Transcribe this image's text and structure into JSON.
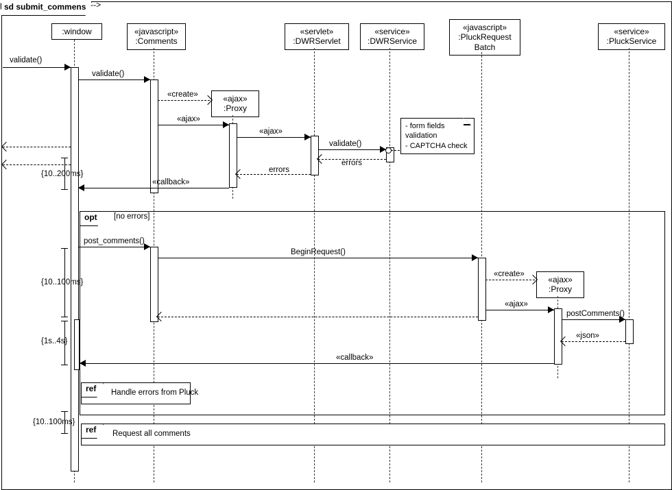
{
  "frame": {
    "title": "sd submit_commens"
  },
  "lifelines": {
    "window": {
      "stereotype": "",
      "name": ":window"
    },
    "comments": {
      "stereotype": "«javascript»",
      "name": ":Comments"
    },
    "proxy1": {
      "stereotype": "«ajax»",
      "name": ":Proxy"
    },
    "dwrservlet": {
      "stereotype": "«servlet»",
      "name": ":DWRServlet"
    },
    "dwrservice": {
      "stereotype": "«service»",
      "name": ":DWRService"
    },
    "pluckreq": {
      "stereotype": "«javascript»",
      "name": ":PluckRequest",
      "name2": "Batch"
    },
    "proxy2": {
      "stereotype": "«ajax»",
      "name": ":Proxy"
    },
    "pluckservice": {
      "stereotype": "«service»",
      "name": ":PluckService"
    }
  },
  "messages": {
    "m_validate_in": "validate()",
    "m_validate_to_c": "validate()",
    "m_create1": "«create»",
    "m_ajax1": "«ajax»",
    "m_ajax2": "«ajax»",
    "m_validate_srv": "validate()",
    "m_errors1": "errors",
    "m_errors2": "errors",
    "m_callback1": "«callback»",
    "m_postcomments": "post_comments()",
    "m_beginreq": "BeginRequest()",
    "m_create2": "«create»",
    "m_ajax3": "«ajax»",
    "m_postc": "postComments()",
    "m_json": "«json»",
    "m_callback2": "«callback»"
  },
  "note": {
    "l1": "- form fields",
    "l2": "validation",
    "l3": "- CAPTCHA check"
  },
  "durations": {
    "d1": "{10..200ms}",
    "d2": "{10..100ms}",
    "d3": "{1s..4s}",
    "d4": "{10..100ms}"
  },
  "fragments": {
    "opt": {
      "op": "opt",
      "guard": "[no errors]"
    },
    "ref1": {
      "op": "ref",
      "text": "Handle errors from Pluck"
    },
    "ref2": {
      "op": "ref",
      "text": "Request all comments"
    }
  },
  "chart_data": {
    "type": "sequence-diagram",
    "frame": "sd submit_commens",
    "lifelines": [
      {
        "id": "window",
        "name": ":window"
      },
      {
        "id": "comments",
        "stereotype": "javascript",
        "name": ":Comments"
      },
      {
        "id": "proxy1",
        "stereotype": "ajax",
        "name": ":Proxy",
        "created_by": "comments"
      },
      {
        "id": "dwrservlet",
        "stereotype": "servlet",
        "name": ":DWRServlet"
      },
      {
        "id": "dwrservice",
        "stereotype": "service",
        "name": ":DWRService"
      },
      {
        "id": "pluckreq",
        "stereotype": "javascript",
        "name": ":PluckRequestBatch"
      },
      {
        "id": "proxy2",
        "stereotype": "ajax",
        "name": ":Proxy",
        "created_by": "pluckreq"
      },
      {
        "id": "pluckservice",
        "stereotype": "service",
        "name": ":PluckService"
      }
    ],
    "messages": [
      {
        "from": "(external)",
        "to": "window",
        "label": "validate()",
        "dashed": false
      },
      {
        "from": "window",
        "to": "comments",
        "label": "validate()",
        "dashed": false
      },
      {
        "from": "comments",
        "to": "proxy1",
        "label": "«create»",
        "dashed": true
      },
      {
        "from": "comments",
        "to": "proxy1",
        "label": "«ajax»",
        "dashed": false
      },
      {
        "from": "proxy1",
        "to": "dwrservlet",
        "label": "«ajax»",
        "dashed": false
      },
      {
        "from": "dwrservlet",
        "to": "dwrservice",
        "label": "validate()",
        "dashed": false,
        "note": "- form fields validation - CAPTCHA check"
      },
      {
        "from": "dwrservice",
        "to": "dwrservlet",
        "label": "errors",
        "dashed": true
      },
      {
        "from": "dwrservlet",
        "to": "proxy1",
        "label": "errors",
        "dashed": true
      },
      {
        "from": "proxy1",
        "to": "window",
        "label": "",
        "dashed": true
      },
      {
        "from": "proxy1",
        "to": "window",
        "label": "«callback»",
        "dashed": false
      }
    ],
    "fragments": [
      {
        "type": "opt",
        "guard": "[no errors]",
        "messages": [
          {
            "from": "window",
            "to": "comments",
            "label": "post_comments()",
            "dashed": false
          },
          {
            "from": "comments",
            "to": "pluckreq",
            "label": "BeginRequest()",
            "dashed": false
          },
          {
            "from": "pluckreq",
            "to": "proxy2",
            "label": "«create»",
            "dashed": true
          },
          {
            "from": "pluckreq",
            "to": "proxy2",
            "label": "«ajax»",
            "dashed": false
          },
          {
            "from": "proxy2",
            "to": "pluckservice",
            "label": "postComments()",
            "dashed": false
          },
          {
            "from": "pluckservice",
            "to": "proxy2",
            "label": "«json»",
            "dashed": true
          },
          {
            "from": "proxy2",
            "to": "comments",
            "label": "",
            "dashed": true
          },
          {
            "from": "proxy2",
            "to": "window",
            "label": "«callback»",
            "dashed": false
          }
        ],
        "refs": [
          {
            "type": "ref",
            "text": "Handle errors from Pluck",
            "covers": [
              "window",
              "comments"
            ]
          }
        ]
      },
      {
        "type": "ref",
        "text": "Request all comments",
        "covers": [
          "window",
          "comments",
          "dwrservlet",
          "dwrservice",
          "pluckreq",
          "pluckservice"
        ]
      }
    ],
    "durations": [
      {
        "label": "{10..200ms}",
        "between": [
          "validate() external",
          "«callback» return"
        ]
      },
      {
        "label": "{10..100ms}",
        "between": [
          "post_comments()",
          "proxy2 return"
        ]
      },
      {
        "label": "{1s..4s}",
        "between": [
          "proxy2 return",
          "«callback» return 2"
        ]
      },
      {
        "label": "{10..100ms}",
        "between": [
          "ref1",
          "ref2"
        ]
      }
    ]
  }
}
